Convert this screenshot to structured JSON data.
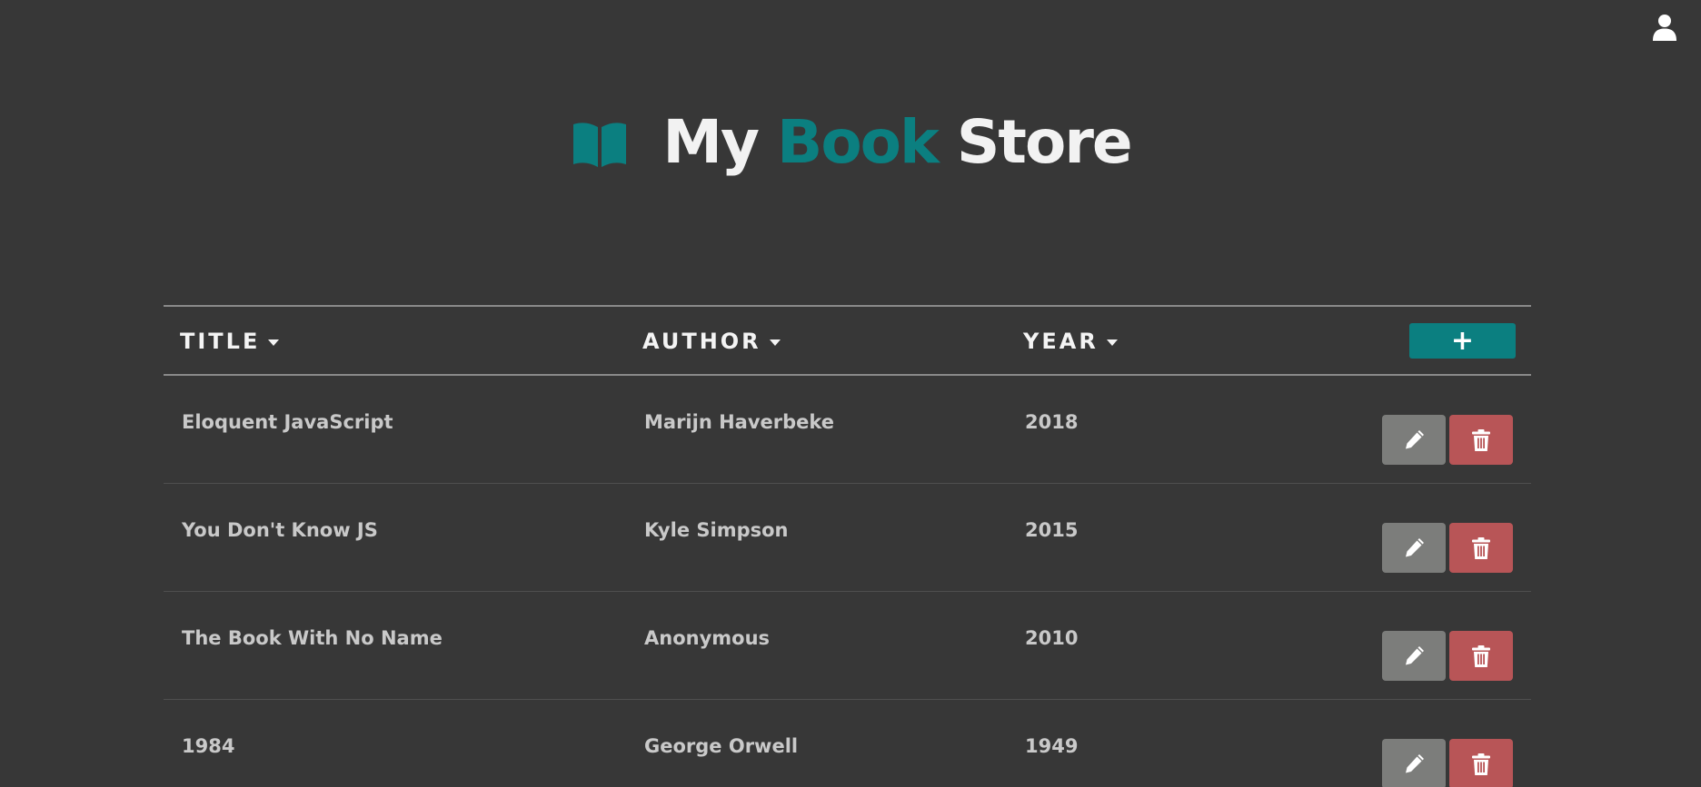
{
  "header": {
    "title_part1": "My ",
    "title_accent": "Book",
    "title_part2": " Store",
    "logo_icon": "open-book-icon"
  },
  "user_menu": {
    "icon": "user-icon"
  },
  "table": {
    "columns": [
      {
        "label": "TITLE",
        "sort_icon": "caret-down-icon"
      },
      {
        "label": "AUTHOR",
        "sort_icon": "caret-down-icon"
      },
      {
        "label": "YEAR",
        "sort_icon": "caret-down-icon"
      }
    ],
    "add_label": "+",
    "rows": [
      {
        "title": "Eloquent JavaScript",
        "author": "Marijn Haverbeke",
        "year": "2018"
      },
      {
        "title": "You Don't Know JS",
        "author": "Kyle Simpson",
        "year": "2015"
      },
      {
        "title": "The Book With No Name",
        "author": "Anonymous",
        "year": "2010"
      },
      {
        "title": "1984",
        "author": "George Orwell",
        "year": "1949"
      }
    ],
    "row_actions": {
      "edit_icon": "pencil-icon",
      "delete_icon": "trash-icon"
    }
  },
  "colors": {
    "background": "#373737",
    "accent": "#0b7f80",
    "edit_button": "#7c7d7b",
    "delete_button": "#b85557",
    "text_primary": "#f2f2f2",
    "text_cell": "#c9c9c9"
  }
}
